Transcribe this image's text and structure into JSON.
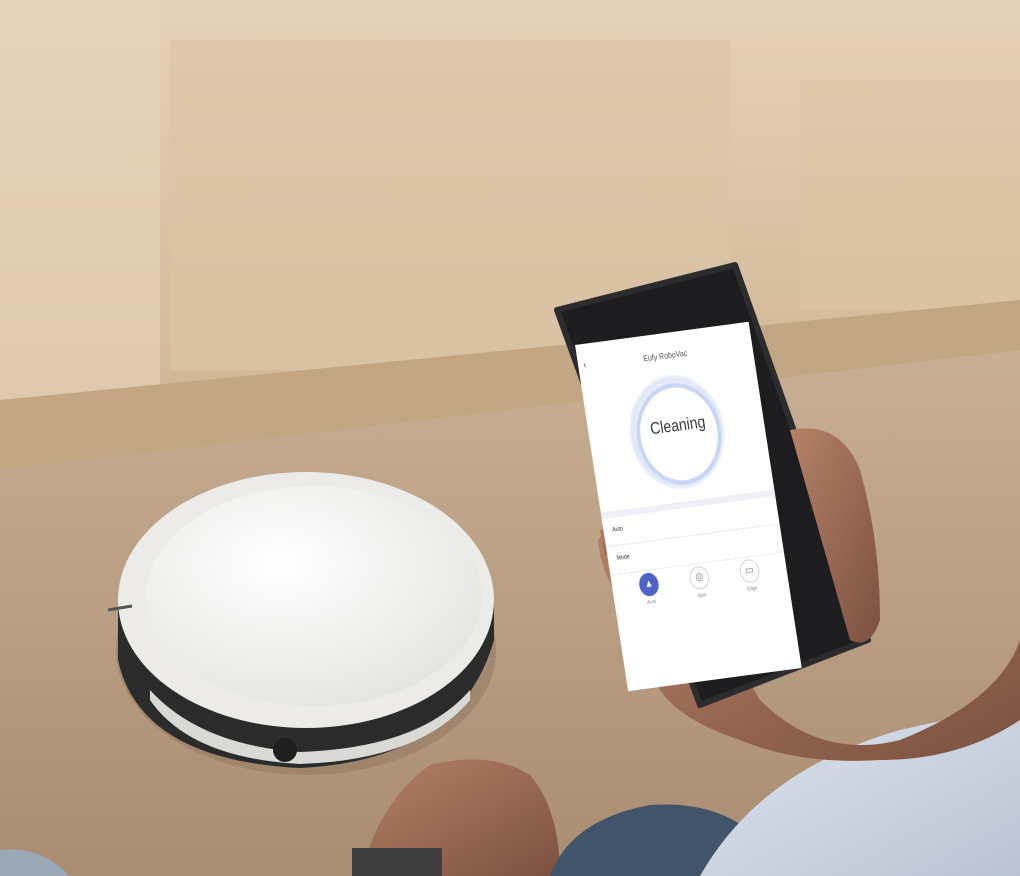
{
  "scene": {
    "description_tag": "photo-robot-vacuum-app"
  },
  "phone": {
    "status_bar": {
      "time": "",
      "icons": ""
    },
    "header": {
      "device_name": "Eufy RoboVac"
    },
    "dial": {
      "status": "Cleaning",
      "subtext": ""
    },
    "rows": [
      {
        "label": "Auto",
        "value": ""
      },
      {
        "label": "Mode",
        "value": ""
      }
    ],
    "modes": [
      {
        "label": "Auto",
        "icon": "triangle-icon",
        "active": true
      },
      {
        "label": "Spot",
        "icon": "target-icon",
        "active": false
      },
      {
        "label": "Edge",
        "icon": "edge-icon",
        "active": false
      }
    ]
  },
  "colors": {
    "accent": "#4d63c9",
    "dial_ring": "#c9d5f4",
    "robot_body": "#f3f3f1",
    "floor": "#b79c81",
    "cabinet": "#d6bea0"
  }
}
